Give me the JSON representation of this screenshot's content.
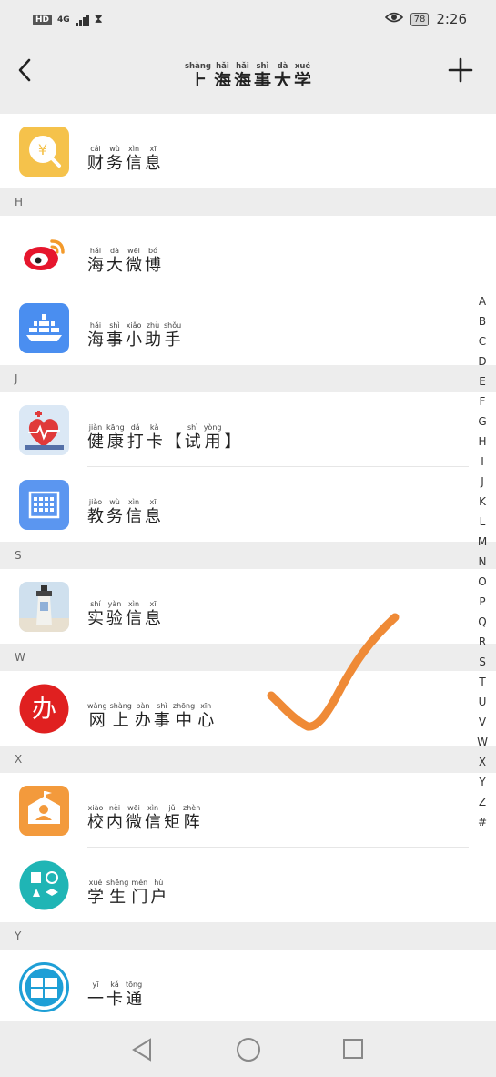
{
  "status": {
    "network": "4G",
    "hd": "HD",
    "battery": "78",
    "time": "2:26"
  },
  "nav": {
    "title": [
      {
        "py": "shàng",
        "h": "上"
      },
      {
        "py": "hǎi",
        "h": "海"
      },
      {
        "py": "hǎi",
        "h": "海"
      },
      {
        "py": "shì",
        "h": "事"
      },
      {
        "py": "dà",
        "h": "大"
      },
      {
        "py": "xué",
        "h": "学"
      }
    ]
  },
  "sections": [
    {
      "letter": "",
      "items": [
        {
          "icon": "finance-icon",
          "color": "#f5c24b",
          "label": [
            {
              "py": "cái",
              "h": "财"
            },
            {
              "py": "wù",
              "h": "务"
            },
            {
              "py": "xìn",
              "h": "信"
            },
            {
              "py": "xī",
              "h": "息"
            }
          ]
        }
      ]
    },
    {
      "letter": "H",
      "items": [
        {
          "icon": "weibo-icon",
          "color": "#ffffff",
          "label": [
            {
              "py": "hǎi",
              "h": "海"
            },
            {
              "py": "dà",
              "h": "大"
            },
            {
              "py": "wēi",
              "h": "微"
            },
            {
              "py": "bó",
              "h": "博"
            }
          ]
        },
        {
          "icon": "ship-icon",
          "color": "#4a8ef0",
          "label": [
            {
              "py": "hǎi",
              "h": "海"
            },
            {
              "py": "shì",
              "h": "事"
            },
            {
              "py": "xiǎo",
              "h": "小"
            },
            {
              "py": "zhù",
              "h": "助"
            },
            {
              "py": "shǒu",
              "h": "手"
            }
          ]
        }
      ]
    },
    {
      "letter": "J",
      "items": [
        {
          "icon": "health-icon",
          "color": "#dbe8f5",
          "label": [
            {
              "py": "jiàn",
              "h": "健"
            },
            {
              "py": "kāng",
              "h": "康"
            },
            {
              "py": "dǎ",
              "h": "打"
            },
            {
              "py": "kǎ",
              "h": "卡"
            },
            {
              "py": "",
              "h": "【"
            },
            {
              "py": "shì",
              "h": "试"
            },
            {
              "py": "yòng",
              "h": "用"
            },
            {
              "py": "",
              "h": "】"
            }
          ]
        },
        {
          "icon": "calendar-icon",
          "color": "#5b96f0",
          "label": [
            {
              "py": "jiào",
              "h": "教"
            },
            {
              "py": "wù",
              "h": "务"
            },
            {
              "py": "xìn",
              "h": "信"
            },
            {
              "py": "xī",
              "h": "息"
            }
          ]
        }
      ]
    },
    {
      "letter": "S",
      "items": [
        {
          "icon": "lighthouse-icon",
          "color": "#cfe0ee",
          "label": [
            {
              "py": "shí",
              "h": "实"
            },
            {
              "py": "yàn",
              "h": "验"
            },
            {
              "py": "xìn",
              "h": "信"
            },
            {
              "py": "xī",
              "h": "息"
            }
          ]
        }
      ]
    },
    {
      "letter": "W",
      "items": [
        {
          "icon": "office-icon",
          "color": "#e02020",
          "label": [
            {
              "py": "wǎng",
              "h": "网"
            },
            {
              "py": "shàng",
              "h": "上"
            },
            {
              "py": "bàn",
              "h": "办"
            },
            {
              "py": "shì",
              "h": "事"
            },
            {
              "py": "zhōng",
              "h": "中"
            },
            {
              "py": "xīn",
              "h": "心"
            }
          ]
        }
      ]
    },
    {
      "letter": "X",
      "items": [
        {
          "icon": "campus-icon",
          "color": "#f39a3c",
          "label": [
            {
              "py": "xiào",
              "h": "校"
            },
            {
              "py": "nèi",
              "h": "内"
            },
            {
              "py": "wēi",
              "h": "微"
            },
            {
              "py": "xìn",
              "h": "信"
            },
            {
              "py": "jǔ",
              "h": "矩"
            },
            {
              "py": "zhèn",
              "h": "阵"
            }
          ]
        },
        {
          "icon": "student-icon",
          "color": "#1fb5b5",
          "label": [
            {
              "py": "xué",
              "h": "学"
            },
            {
              "py": "shēng",
              "h": "生"
            },
            {
              "py": "mén",
              "h": "门"
            },
            {
              "py": "hù",
              "h": "户"
            }
          ]
        }
      ]
    },
    {
      "letter": "Y",
      "items": [
        {
          "icon": "card-icon",
          "color": "#1e9fd6",
          "label": [
            {
              "py": "yī",
              "h": "一"
            },
            {
              "py": "kǎ",
              "h": "卡"
            },
            {
              "py": "tōng",
              "h": "通"
            }
          ]
        }
      ]
    }
  ],
  "index": [
    "A",
    "B",
    "C",
    "D",
    "E",
    "F",
    "G",
    "H",
    "I",
    "J",
    "K",
    "L",
    "M",
    "N",
    "O",
    "P",
    "Q",
    "R",
    "S",
    "T",
    "U",
    "V",
    "W",
    "X",
    "Y",
    "Z",
    "#"
  ]
}
